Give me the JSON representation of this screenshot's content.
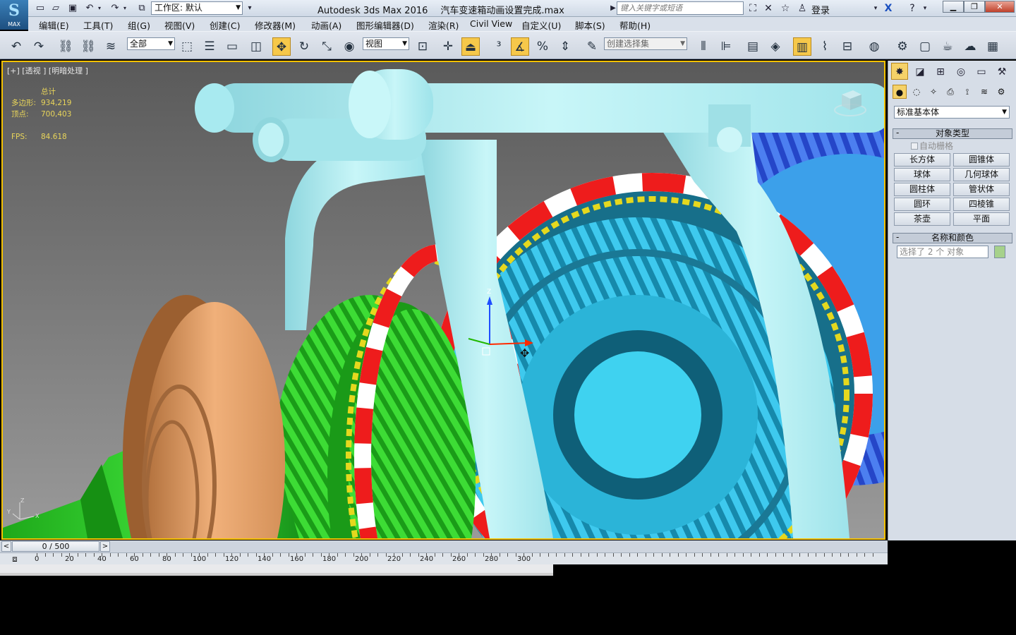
{
  "app": {
    "logo_label": "MAX",
    "workspace_label": "工作区: 默认",
    "product": "Autodesk 3ds Max 2016",
    "file": "汽车变速箱动画设置完成.max",
    "search_placeholder": "键入关键字或短语",
    "login": "登录"
  },
  "menu": [
    "编辑(E)",
    "工具(T)",
    "组(G)",
    "视图(V)",
    "创建(C)",
    "修改器(M)",
    "动画(A)",
    "图形编辑器(D)",
    "渲染(R)",
    "Civil View",
    "自定义(U)",
    "脚本(S)",
    "帮助(H)"
  ],
  "toolbar": {
    "filter_value": "全部",
    "coord_value": "视图",
    "selection_set_placeholder": "创建选择集"
  },
  "viewport": {
    "label": "[+] [透视 ] [明暗处理 ]",
    "stats_title": "总计",
    "polys_label": "多边形:",
    "polys_value": "934,219",
    "verts_label": "顶点:",
    "verts_value": "700,403",
    "fps_label": "FPS:",
    "fps_value": "84.618",
    "axis_x": "X",
    "axis_y": "Y",
    "axis_z": "Z"
  },
  "command_panel": {
    "category": "标准基本体",
    "object_type_title": "对象类型",
    "autogrid_label": "自动栅格",
    "buttons": [
      "长方体",
      "圆锥体",
      "球体",
      "几何球体",
      "圆柱体",
      "管状体",
      "圆环",
      "四棱锥",
      "茶壶",
      "平面"
    ],
    "name_color_title": "名称和颜色",
    "name_value": "选择了 2 个 对象",
    "object_color": "#a6d18b"
  },
  "timeline": {
    "frame_display": "0 / 500",
    "ticks": [
      "0",
      "20",
      "40",
      "60",
      "80",
      "100",
      "120",
      "140",
      "160",
      "180",
      "200",
      "220",
      "240",
      "260",
      "280",
      "300"
    ]
  },
  "colors": {
    "active_viewport_border": "#f5c200",
    "gear_cyan": "#35c6ea",
    "gear_green": "#2fd42b",
    "gear_blue": "#3b4fe0",
    "bearing_tan": "#e3a06a",
    "ring_red": "#ee1c1c",
    "fork_lightblue": "#b8f0f4"
  }
}
